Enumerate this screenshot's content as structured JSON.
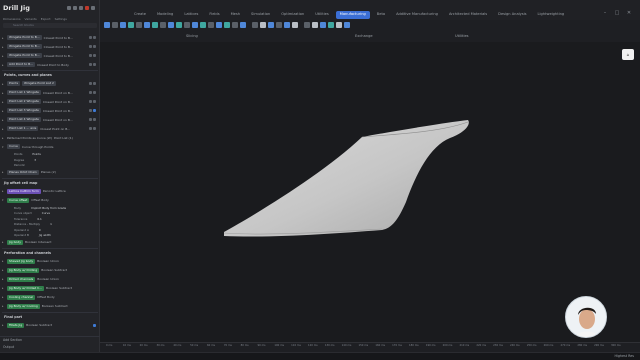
{
  "menu": {
    "tabs": [
      "Create",
      "Modeling",
      "Lattices",
      "Fields",
      "Mesh",
      "Simulation",
      "Optimization",
      "Utilities",
      "Manufacturing",
      "Beta",
      "Additive Manufacturing",
      "Architected Materials",
      "Design Analysis",
      "Lightweighting"
    ],
    "active_tab": "Manufacturing"
  },
  "ribbon": {
    "group_labels": [
      "Slicing",
      "Exchange",
      "Utilities"
    ]
  },
  "panel": {
    "title": "Drill Jig",
    "tabs": [
      "Dimensions",
      "Variants",
      "Export",
      "Settings"
    ],
    "search_placeholder": "Search blocks",
    "rows_top": [
      {
        "chip": "Wingate Point to B...",
        "text": "Closest Point to B..."
      },
      {
        "chip": "Wingate Point to B...",
        "text": "Closest Point to B..."
      },
      {
        "chip": "Wingate Point to B...",
        "text": "Closest Point to B..."
      },
      {
        "chip": "Add Point to B...",
        "text": "Closest Point to Body"
      }
    ],
    "section_points": "Points, curves and planes",
    "rows_points": [
      {
        "chip": "Points",
        "text": "Wingate Point List 2"
      },
      {
        "chip": "Point List 1 Wingate",
        "text": "Closest Point on B..."
      },
      {
        "chip": "Point List 2 Wingate",
        "text": "Closest Point on B..."
      },
      {
        "chip": "Point List 3 Wingate",
        "text": "Closest Point on B..."
      },
      {
        "chip": "Point List 4 Wingate",
        "text": "Closest Point on B..."
      },
      {
        "chip": "Point List 1 ... axis",
        "text": "Closest Point on B..."
      }
    ],
    "row_pattern": {
      "text": "Patterned Points as Curve (W)",
      "tail": "Point List (1)"
    },
    "row_curve": {
      "chip": "Curve",
      "text": "Curve through Points"
    },
    "curve_params": [
      {
        "label": "Points",
        "value": "Points"
      },
      {
        "label": "Degree",
        "value": "3"
      },
      {
        "label": "Periodic",
        "value": ""
      }
    ],
    "row_planes": {
      "chip": "Planes Orbit Chain",
      "text": "Planes (2)"
    },
    "section_offset": "Jig offset cell map",
    "row_lattice": {
      "chip": "Lattice CuBlim form",
      "text": "Periodic Lattice"
    },
    "row_offset": {
      "chip": "Curve offset",
      "text": "Offset Body"
    },
    "offset_params": [
      {
        "label": "Body",
        "value": "Implicit Body from Grade"
      },
      {
        "label": "Curve object",
        "value": "Curve"
      },
      {
        "label": "Tolerance",
        "value": "0.1"
      },
      {
        "label": "Distance - Multiply",
        "value": "1"
      },
      {
        "label": "Operand A",
        "value": "0"
      },
      {
        "label": "Operand B",
        "value": "Jig width"
      }
    ],
    "row_jigbody": {
      "chip": "Jig body",
      "text": "Boolean Intersect"
    },
    "section_perforation": "Perforation and channels",
    "rows_perforation": [
      {
        "chip": "Shaved Jig body",
        "text": "Boolean Union"
      },
      {
        "chip": "Jig Body w/ Drilling",
        "text": "Boolean Subtract"
      },
      {
        "chip": "Drilled channels",
        "text": "Boolean Union"
      },
      {
        "chip": "Jig Body w/ Drilled h...",
        "text": "Boolean Subtract"
      },
      {
        "chip": "Cooling channel",
        "text": "Offset Body"
      },
      {
        "chip": "Jig Body w/ Cooling",
        "text": "Boolean Subtract"
      }
    ],
    "section_final": "Final part",
    "row_final": {
      "chip": "Fillets Jig",
      "text": "Boolean Subtract"
    },
    "footer": [
      "Add Section",
      "Output"
    ]
  },
  "timeline": {
    "ticks": [
      "0 ms",
      "10 ms",
      "20 ms",
      "30 ms",
      "40 ms",
      "50 ms",
      "60 ms",
      "70 ms",
      "80 ms",
      "90 ms",
      "100 ms",
      "110 ms",
      "120 ms",
      "130 ms",
      "140 ms",
      "150 ms",
      "160 ms",
      "170 ms",
      "180 ms",
      "190 ms",
      "200 ms",
      "210 ms",
      "220 ms",
      "230 ms",
      "240 ms",
      "250 ms",
      "260 ms",
      "270 ms",
      "280 ms",
      "290 ms",
      "300 ms"
    ]
  },
  "status": {
    "right": "Highest Res"
  },
  "colors": {
    "accent": "#3b6fd6",
    "green": "#2f7d4a",
    "purple": "#6b4fb5",
    "shape": "#c9c9c9"
  }
}
